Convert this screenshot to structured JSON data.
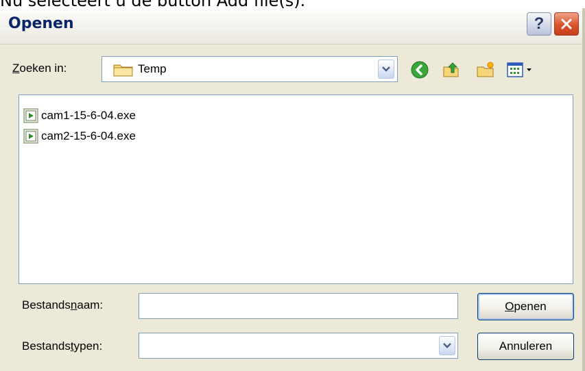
{
  "caption": "Nu selecteert u de button Add file(s).",
  "dialog": {
    "title": "Openen",
    "help_label": "?",
    "lookin": {
      "label_first": "Z",
      "label_rest": "oeken in:",
      "value": "Temp"
    },
    "toolbar": {
      "back": "back-icon",
      "up": "up-folder-icon",
      "newfolder": "new-folder-icon",
      "views": "views-menu-icon"
    },
    "files": [
      {
        "name": "cam1-15-6-04.exe"
      },
      {
        "name": "cam2-15-6-04.exe"
      }
    ],
    "filename": {
      "label_pre": "Bestands",
      "label_u": "n",
      "label_post": "aam:",
      "value": ""
    },
    "filetype": {
      "label_pre": "Bestands",
      "label_u": "t",
      "label_post": "ypen:",
      "value": ""
    },
    "buttons": {
      "open_u": "O",
      "open_rest": "penen",
      "cancel": "Annuleren"
    }
  },
  "colors": {
    "dialog_bg": "#ece9d8",
    "title_text": "#0a246a",
    "field_border": "#7f9db9",
    "close_red": "#d9532c"
  }
}
